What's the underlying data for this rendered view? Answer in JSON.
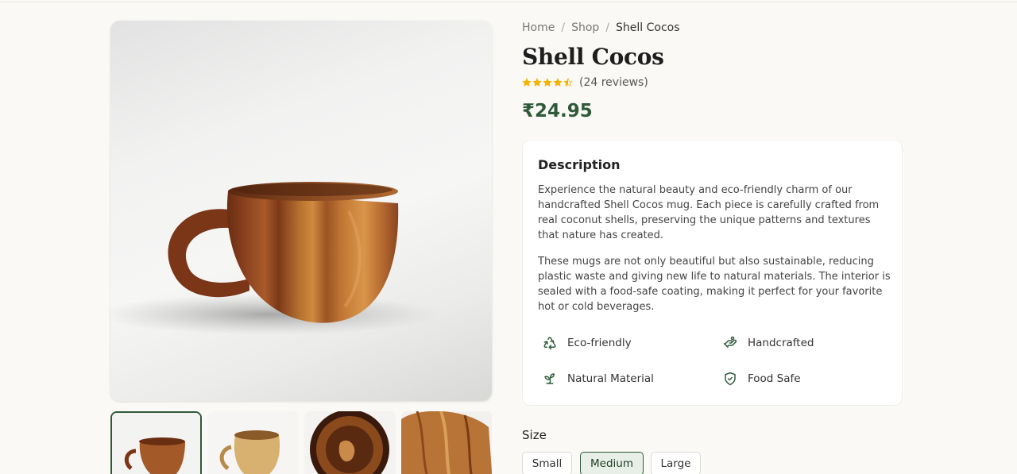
{
  "breadcrumb": {
    "items": [
      "Home",
      "Shop"
    ],
    "separator": "/",
    "current": "Shell Cocos"
  },
  "product": {
    "title": "Shell Cocos",
    "rating": 4.5,
    "rating_max": 5,
    "reviews_label": "(24 reviews)",
    "price": "₹24.95"
  },
  "description": {
    "heading": "Description",
    "paragraph1": "Experience the natural beauty and eco-friendly charm of our handcrafted Shell Cocos mug. Each piece is carefully crafted from real coconut shells, preserving the unique patterns and textures that nature has created.",
    "paragraph2": "These mugs are not only beautiful but also sustainable, reducing plastic waste and giving new life to natural materials. The interior is sealed with a food-safe coating, making it perfect for your favorite hot or cold beverages."
  },
  "features": [
    {
      "label": "Eco-friendly",
      "icon": "recycle-icon"
    },
    {
      "label": "Handcrafted",
      "icon": "hand-icon"
    },
    {
      "label": "Natural Material",
      "icon": "sprout-icon"
    },
    {
      "label": "Food Safe",
      "icon": "shield-check-icon"
    }
  ],
  "size": {
    "label": "Size",
    "options": [
      "Small",
      "Medium",
      "Large"
    ],
    "selected": "Medium"
  },
  "gallery": {
    "thumbnail_count": 4,
    "active_index": 0
  },
  "colors": {
    "accent": "#2f5a3a",
    "star": "#f5b301",
    "background": "#faf9f5"
  }
}
